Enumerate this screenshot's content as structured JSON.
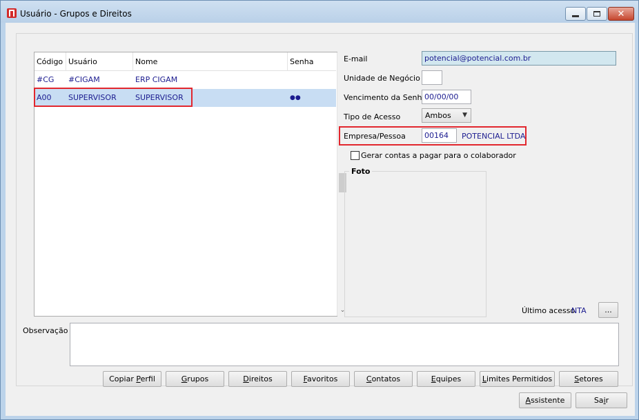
{
  "window": {
    "title": "Usuário - Grupos e Direitos",
    "close_glyph": "✕"
  },
  "grid": {
    "columns": [
      "Código",
      "Usuário",
      "Nome",
      "Senha"
    ],
    "rows": [
      {
        "codigo": "#CG",
        "usuario": "#CIGAM",
        "nome": "ERP CIGAM",
        "senha": ""
      },
      {
        "codigo": "A00",
        "usuario": "SUPERVISOR",
        "nome": "SUPERVISOR",
        "senha": "●●"
      }
    ],
    "scroll_up_glyph": "▲",
    "scroll_down_glyph": "⌄"
  },
  "form": {
    "email_label": "E-mail",
    "email_value": "potencial@potencial.com.br",
    "unidade_label": "Unidade de Negócio",
    "unidade_value": "",
    "vencimento_label": "Vencimento da Senha",
    "vencimento_value": "00/00/00",
    "tipo_label": "Tipo de Acesso",
    "tipo_value": "Ambos",
    "empresa_label": "Empresa/Pessoa",
    "empresa_code": "00164",
    "empresa_name": "POTENCIAL LTDA",
    "gerar_label": "Gerar contas a pagar para o colaborador",
    "gerar_checked": false,
    "foto_label": "Foto",
    "ultimo_label": "Último acesso",
    "ultimo_value": "NTA",
    "ellipsis_label": "...",
    "observacao_label": "Observação"
  },
  "buttons": [
    {
      "pre": "Copiar ",
      "ul": "P",
      "post": "erfil"
    },
    {
      "pre": "",
      "ul": "G",
      "post": "rupos"
    },
    {
      "pre": "",
      "ul": "D",
      "post": "ireitos"
    },
    {
      "pre": "",
      "ul": "F",
      "post": "avoritos"
    },
    {
      "pre": "",
      "ul": "C",
      "post": "ontatos"
    },
    {
      "pre": "",
      "ul": "E",
      "post": "quipes"
    },
    {
      "pre": "",
      "ul": "L",
      "post": "imites Permitidos"
    },
    {
      "pre": "",
      "ul": "S",
      "post": "etores"
    }
  ],
  "footer": {
    "assistente": {
      "pre": "",
      "ul": "A",
      "post": "ssistente"
    },
    "sair": {
      "pre": "Sa",
      "ul": "i",
      "post": "r"
    }
  },
  "colors": {
    "accent_text": "#1b1b8f",
    "highlight_box": "#e2262d",
    "selected_row": "#c8ddf3"
  }
}
